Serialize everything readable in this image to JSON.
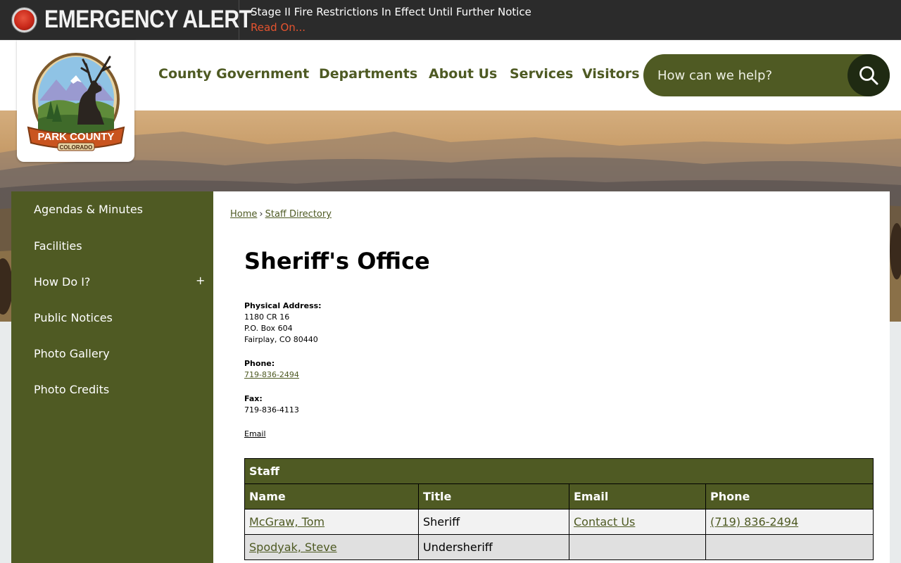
{
  "alert": {
    "title": "EMERGENCY ALERT",
    "message": "Stage II Fire Restrictions In Effect Until Further Notice",
    "link": "Read On..."
  },
  "logo": {
    "line1": "PARK COUNTY",
    "line2": "COLORADO"
  },
  "nav": {
    "items": [
      "County Government",
      "Departments",
      "About Us",
      "Services",
      "Visitors"
    ]
  },
  "search": {
    "placeholder": "How can we help?",
    "icon": "search-icon"
  },
  "sidebar": {
    "items": [
      {
        "label": "Agendas & Minutes"
      },
      {
        "label": "Facilities"
      },
      {
        "label": "How Do I?",
        "expander": "+"
      },
      {
        "label": "Public Notices"
      },
      {
        "label": "Photo Gallery"
      },
      {
        "label": "Photo Credits"
      }
    ]
  },
  "breadcrumb": {
    "home": "Home",
    "separator": "›",
    "current": "Staff Directory"
  },
  "page": {
    "title": "Sheriff's Office",
    "address_label": "Physical Address:",
    "address_lines": [
      "1180 CR 16",
      "P.O. Box 604",
      "Fairplay, CO 80440"
    ],
    "phone_label": "Phone:",
    "phone": "719-836-2494",
    "fax_label": "Fax:",
    "fax": "719-836-4113",
    "email_link": "Email"
  },
  "staff_table": {
    "caption": "Staff",
    "columns": [
      "Name",
      "Title",
      "Email",
      "Phone"
    ],
    "rows": [
      {
        "name": "McGraw, Tom",
        "title": "Sheriff",
        "email": "Contact Us",
        "phone": "(719) 836-2494"
      },
      {
        "name": "Spodyak, Steve",
        "title": "Undersheriff",
        "email": "",
        "phone": ""
      }
    ]
  },
  "colors": {
    "brand_green": "#4f5a23",
    "alert_bg": "#2b2b2b",
    "alert_link": "#e4532f",
    "search_button": "#1f2a12"
  }
}
